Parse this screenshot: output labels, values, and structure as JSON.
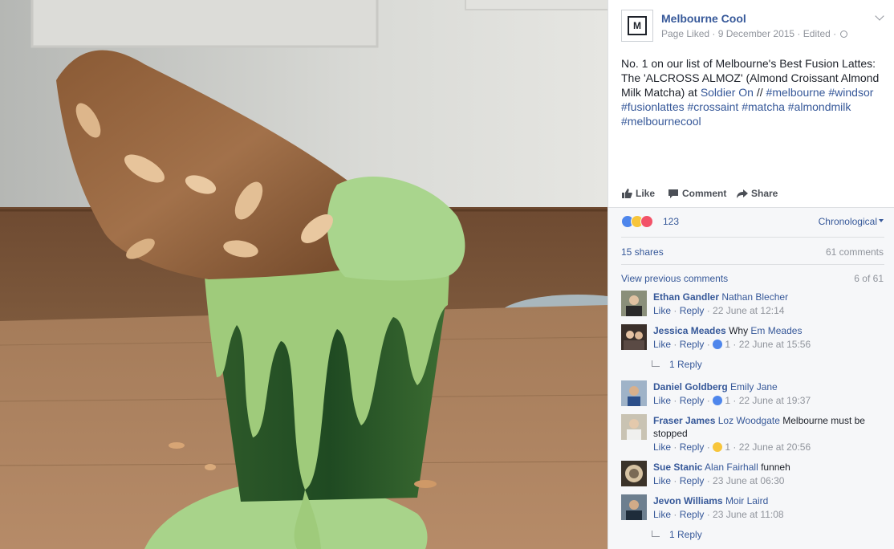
{
  "colors": {
    "link": "#365899",
    "meta": "#90949c",
    "text": "#1d2129",
    "matcha": "#6fb34a"
  },
  "photo": {
    "icon": "matcha-latte-croissant-photo"
  },
  "post": {
    "page_logo_letter": "M",
    "page_name": "Melbourne Cool",
    "meta": "Page Liked · 9 December 2015 · Edited ·",
    "text_1": "No. 1 on our list of Melbourne's Best Fusion Lattes: The 'ALCROSS ALMOZ' (Almond Croissant Almond Milk Matcha) at ",
    "link_place": "Soldier On",
    "text_2": " // ",
    "hashtags": "#melbourne #windsor #fusionlattes #crossaint #matcha #almondmilk #melbournecool"
  },
  "actions": {
    "like": "Like",
    "comment": "Comment",
    "share": "Share"
  },
  "stats": {
    "reactions_count": "123",
    "sort_label": "Chronological",
    "shares": "15 shares",
    "comments": "61 comments",
    "view_previous": "View previous comments",
    "page_count": "6 of 61"
  },
  "comments": [
    {
      "author": "Ethan Gandler",
      "tag": "Nathan Blecher",
      "text": "",
      "like": "Like",
      "reply": "Reply",
      "reaction": "",
      "time": "22 June at 12:14",
      "replies": ""
    },
    {
      "author": "Jessica Meades",
      "tag": "Em Meades",
      "pre": "Why ",
      "text": "",
      "like": "Like",
      "reply": "Reply",
      "reaction": "1",
      "time": "22 June at 15:56",
      "replies": "1 Reply"
    },
    {
      "author": "Daniel Goldberg",
      "tag": "Emily Jane",
      "text": "",
      "like": "Like",
      "reply": "Reply",
      "reaction": "1",
      "time": "22 June at 19:37",
      "replies": ""
    },
    {
      "author": "Fraser James",
      "tag": "Loz Woodgate",
      "text": " Melbourne must be stopped",
      "like": "Like",
      "reply": "Reply",
      "reaction": "1",
      "time": "22 June at 20:56",
      "replies": ""
    },
    {
      "author": "Sue Stanic",
      "tag": "Alan Fairhall",
      "text": " funneh",
      "like": "Like",
      "reply": "Reply",
      "reaction": "",
      "time": "23 June at 06:30",
      "replies": ""
    },
    {
      "author": "Jevon Williams",
      "tag": "Moir Laird",
      "text": "",
      "like": "Like",
      "reply": "Reply",
      "reaction": "",
      "time": "23 June at 11:08",
      "replies": "1 Reply"
    }
  ]
}
